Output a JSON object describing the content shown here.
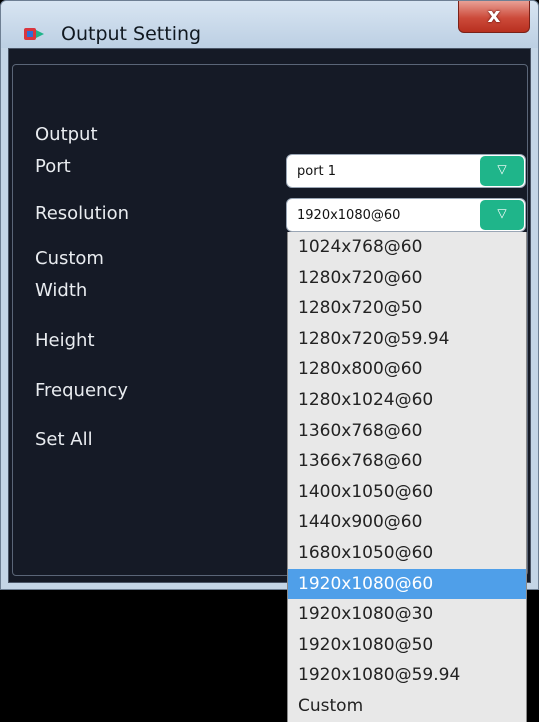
{
  "window": {
    "title": "Output Setting",
    "close_label": "x"
  },
  "labels": {
    "output": "Output",
    "port": "Port",
    "resolution": "Resolution",
    "custom": "Custom",
    "width": "Width",
    "height": "Height",
    "frequency": "Frequency",
    "set_all": "Set All"
  },
  "port_select": {
    "value": "port 1"
  },
  "resolution_select": {
    "value": "1920x1080@60",
    "options": [
      "1024x768@60",
      "1280x720@60",
      "1280x720@50",
      "1280x720@59.94",
      "1280x800@60",
      "1280x1024@60",
      "1360x768@60",
      "1366x768@60",
      "1400x1050@60",
      "1440x900@60",
      "1680x1050@60",
      "1920x1080@60",
      "1920x1080@30",
      "1920x1080@50",
      "1920x1080@59.94",
      "Custom"
    ],
    "highlighted": "1920x1080@60"
  },
  "colors": {
    "accent": "#1fb58a",
    "highlight": "#4f9fe9",
    "panel": "#151a26"
  }
}
